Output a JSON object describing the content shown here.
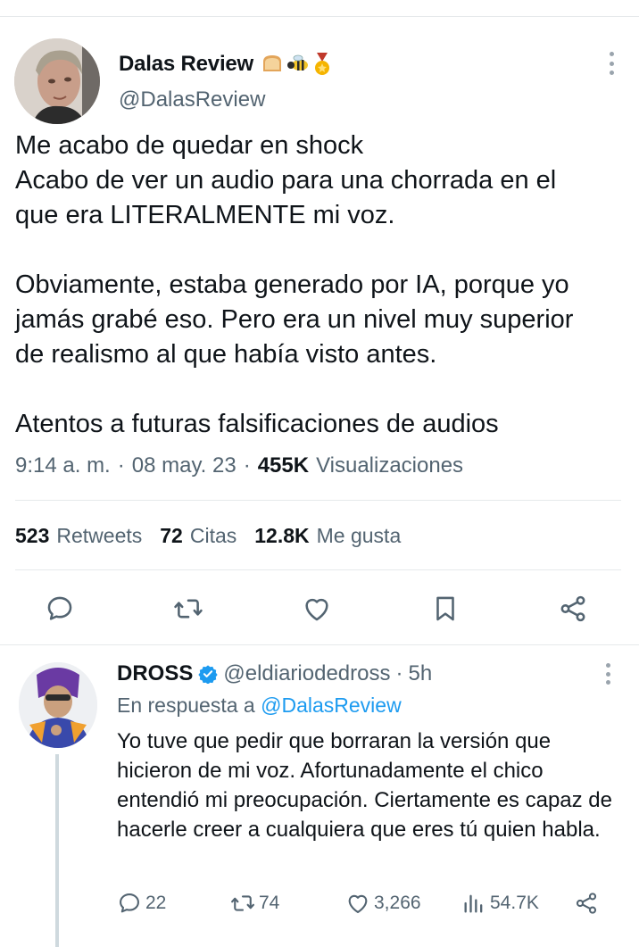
{
  "main_tweet": {
    "author_name": "Dalas Review",
    "emojis": [
      "bread-emoji",
      "bee-emoji",
      "medal-emoji"
    ],
    "handle": "@DalasReview",
    "lines_para1": "Me acabo de quedar en shock\nAcabo de ver un audio para una chorrada en el\nque era LITERALMENTE mi voz.",
    "lines_para2": "Obviamente, estaba generado por IA, porque yo\njamás grabé eso. Pero era un nivel muy superior\nde realismo al que había visto antes.",
    "lines_para3": "Atentos a futuras falsificaciones de audios",
    "time": "9:14 a. m.",
    "sep1": "·",
    "date": "08 may. 23",
    "sep2": "·",
    "views_count": "455K",
    "views_label": "Visualizaciones",
    "stats": {
      "retweets_count": "523",
      "retweets_label": "Retweets",
      "quotes_count": "72",
      "quotes_label": "Citas",
      "likes_count": "12.8K",
      "likes_label": "Me gusta"
    },
    "actions": [
      "reply-icon",
      "retweet-icon",
      "like-icon",
      "bookmark-icon",
      "share-icon"
    ]
  },
  "reply": {
    "author_name": "DROSS",
    "handle": "@eldiariodedross",
    "sep": "·",
    "time": "5h",
    "in_reply_prefix": "En respuesta a",
    "in_reply_handle": "@DalasReview",
    "text": "Yo tuve que pedir que borraran la versión que hicieron de mi voz. Afortunadamente el chico entendió mi preocupación. Ciertamente es capaz de hacerle creer a cualquiera que eres tú quien habla.",
    "counts": {
      "replies": "22",
      "retweets": "74",
      "likes": "3,266",
      "views": "54.7K"
    }
  },
  "colors": {
    "text": "#0f1419",
    "secondary": "#536471",
    "link": "#1d9bf0",
    "divider": "#e6e9eb",
    "verified": "#1d9bf0",
    "icon": "#536471"
  }
}
